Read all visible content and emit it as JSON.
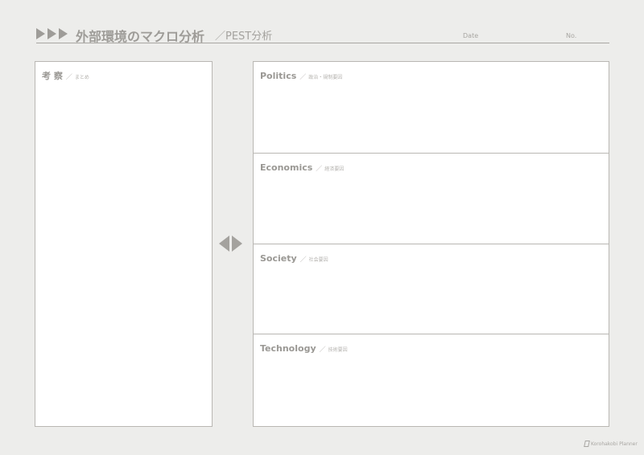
{
  "header": {
    "title": "外部環境のマクロ分析",
    "subtitle": "／PEST分析",
    "date_label": "Date",
    "no_label": "No."
  },
  "summary": {
    "title": "考 察",
    "sep": "／",
    "subtitle": "まとめ"
  },
  "sections": [
    {
      "title": "Politics",
      "sep": "／",
      "subtitle": "政治・規制要因"
    },
    {
      "title": "Economics",
      "sep": "／",
      "subtitle": "経済要因"
    },
    {
      "title": "Society",
      "sep": "／",
      "subtitle": "社会要因"
    },
    {
      "title": "Technology",
      "sep": "／",
      "subtitle": "技術要因"
    }
  ],
  "footer": {
    "brand": "Korohakobi Planner",
    "icon": "pen-icon"
  },
  "icons": {
    "header_arrows": "triangle-right-icon",
    "middle_arrows": "left-right-triangle-icon"
  },
  "colors": {
    "background": "#ededeb",
    "panel": "#ffffff",
    "text": "#9a9894",
    "border": "#b9b7b3"
  }
}
